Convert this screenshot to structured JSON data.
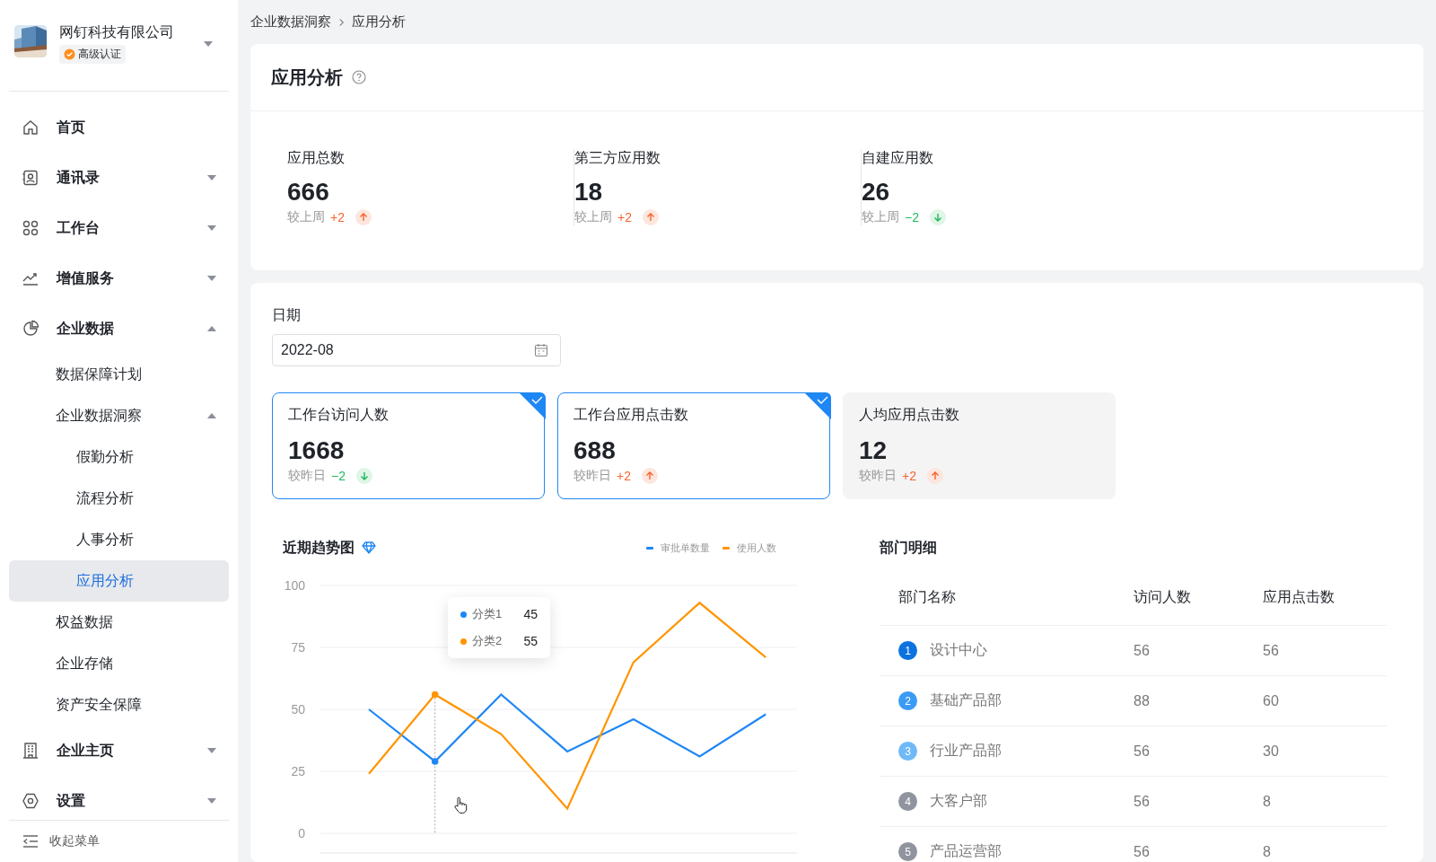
{
  "sidebar": {
    "company": {
      "name": "网钉科技有限公司",
      "badge": "高级认证"
    },
    "nav": [
      {
        "label": "首页",
        "selected": false
      },
      {
        "label": "通讯录",
        "selected": false,
        "expanded": false
      },
      {
        "label": "工作台",
        "selected": false,
        "expanded": false
      },
      {
        "label": "增值服务",
        "selected": false,
        "expanded": false
      },
      {
        "label": "企业数据",
        "selected": false,
        "expanded": true,
        "children": [
          {
            "label": "数据保障计划",
            "selected": false
          },
          {
            "label": "企业数据洞察",
            "selected": false,
            "expanded": true,
            "children": [
              {
                "label": "假勤分析",
                "selected": false
              },
              {
                "label": "流程分析",
                "selected": false
              },
              {
                "label": "人事分析",
                "selected": false
              },
              {
                "label": "应用分析",
                "selected": true
              }
            ]
          },
          {
            "label": "权益数据",
            "selected": false
          },
          {
            "label": "企业存储",
            "selected": false
          },
          {
            "label": "资产安全保障",
            "selected": false
          }
        ]
      },
      {
        "label": "企业主页",
        "selected": false,
        "expanded": false
      },
      {
        "label": "设置",
        "selected": false,
        "expanded": false
      }
    ],
    "collapse": "收起菜单"
  },
  "breadcrumb": [
    "企业数据洞察",
    "应用分析"
  ],
  "overview": {
    "title": "应用分析",
    "stats": [
      {
        "label": "应用总数",
        "value": "666",
        "compare": "较上周",
        "delta": "+2",
        "kind": "increase"
      },
      {
        "label": "第三方应用数",
        "value": "18",
        "compare": "较上周",
        "delta": "+2",
        "kind": "increase"
      },
      {
        "label": "自建应用数",
        "value": "26",
        "compare": "较上周",
        "delta": "−2",
        "kind": "decrease"
      }
    ]
  },
  "detail": {
    "date": {
      "label": "日期",
      "value": "2022-08"
    },
    "metrics": [
      {
        "label": "工作台访问人数",
        "value": "1668",
        "compare": "较昨日",
        "delta": "−2",
        "kind": "decrease",
        "selected": true
      },
      {
        "label": "工作台应用点击数",
        "value": "688",
        "compare": "较昨日",
        "delta": "+2",
        "kind": "increase",
        "selected": true
      },
      {
        "label": "人均应用点击数",
        "value": "12",
        "compare": "较昨日",
        "delta": "+2",
        "kind": "increase",
        "selected": false
      }
    ],
    "trend": {
      "title": "近期趋势图",
      "chart_data": {
        "type": "line",
        "grid": true,
        "ylim": [
          0,
          100
        ],
        "yticks": [
          0,
          25,
          50,
          75,
          100
        ],
        "series": [
          {
            "name": "审批单数量",
            "color": "#1f87f5",
            "values": [
              50,
              29,
              56,
              33,
              46,
              31,
              48
            ]
          },
          {
            "name": "使用人数",
            "color": "#ff9500",
            "values": [
              24,
              56,
              40,
              10,
              69,
              93,
              71
            ]
          }
        ]
      },
      "tooltip": {
        "items": [
          {
            "name": "分类1",
            "value": "45",
            "color": "#1f87f5"
          },
          {
            "name": "分类2",
            "value": "55",
            "color": "#ff9500"
          }
        ]
      }
    },
    "departments": {
      "title": "部门明细",
      "columns": [
        "部门名称",
        "访问人数",
        "应用点击数"
      ],
      "rows": [
        {
          "rank": "1",
          "name": "设计中心",
          "visitors": "56",
          "clicks": "56",
          "color": "#0b72e0"
        },
        {
          "rank": "2",
          "name": "基础产品部",
          "visitors": "88",
          "clicks": "60",
          "color": "#3a9bf5"
        },
        {
          "rank": "3",
          "name": "行业产品部",
          "visitors": "56",
          "clicks": "30",
          "color": "#70b9f8"
        },
        {
          "rank": "4",
          "name": "大客户部",
          "visitors": "56",
          "clicks": "8",
          "color": "#8f949e"
        },
        {
          "rank": "5",
          "name": "产品运营部",
          "visitors": "56",
          "clicks": "8",
          "color": "#8f949e"
        }
      ]
    }
  }
}
